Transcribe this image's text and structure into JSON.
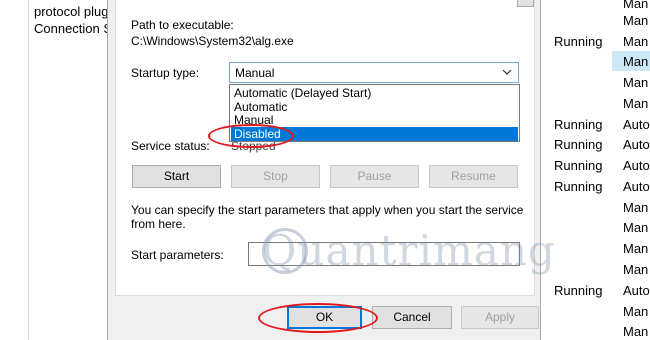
{
  "background": {
    "left_lines": [
      "protocol plug",
      "Connection S"
    ],
    "status_rows": [
      "Running",
      "Running",
      "Running",
      "Running",
      "Running",
      "Running"
    ],
    "startup_rows": [
      "Man",
      "Man",
      "Man",
      "Man",
      "Man",
      "Man",
      "Auto",
      "Auto",
      "Auto",
      "Auto",
      "Man",
      "Man",
      "Man",
      "Man",
      "Auto",
      "Man",
      "Man"
    ]
  },
  "dialog": {
    "path_label": "Path to executable:",
    "path_value": "C:\\Windows\\System32\\alg.exe",
    "startup_label": "Startup type:",
    "startup_value": "Manual",
    "dropdown_options": [
      "Automatic (Delayed Start)",
      "Automatic",
      "Manual",
      "Disabled"
    ],
    "selected_option": "Disabled",
    "service_status_label": "Service status:",
    "service_status_value": "Stopped",
    "buttons": {
      "start": "Start",
      "stop": "Stop",
      "pause": "Pause",
      "resume": "Resume"
    },
    "help_text_1": "You can specify the start parameters that apply when you start the service",
    "help_text_2": "from here.",
    "start_params_label": "Start parameters:",
    "start_params_value": "",
    "footer": {
      "ok": "OK",
      "cancel": "Cancel",
      "apply": "Apply"
    }
  },
  "watermark": "Quantrimang",
  "colors": {
    "accent": "#0078d7",
    "highlight_circle": "#e0191e",
    "selection_row": "#cde8f6"
  }
}
